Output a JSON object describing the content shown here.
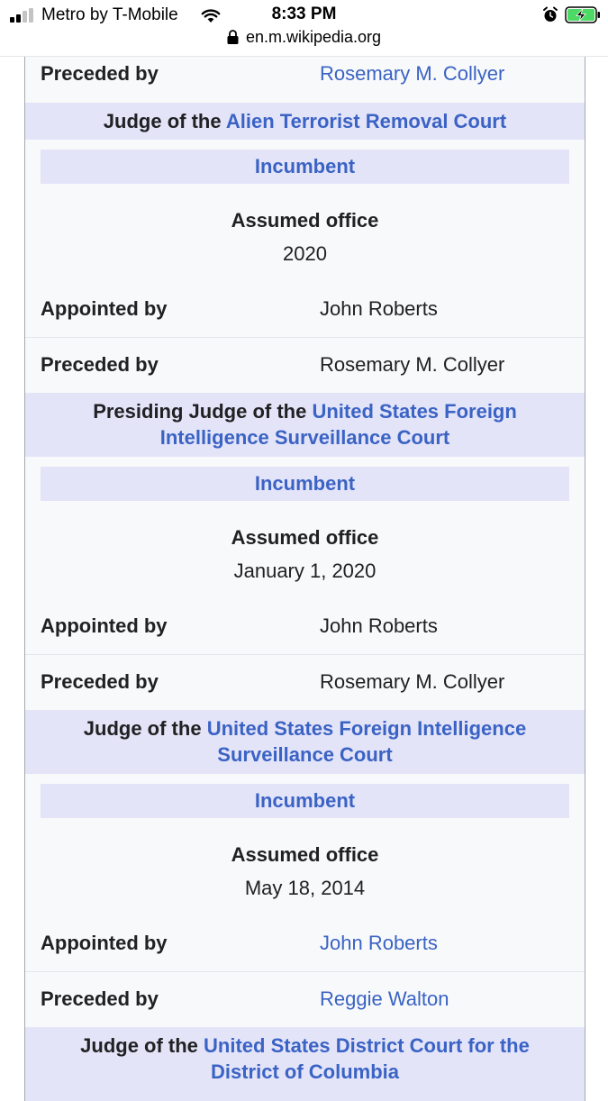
{
  "status_bar": {
    "carrier": "Metro by T-Mobile",
    "time": "8:33 PM",
    "url": "en.m.wikipedia.org",
    "icons": [
      "signal-bars-icon",
      "wifi-icon",
      "alarm-clock-icon",
      "battery-charging-icon",
      "lock-icon"
    ],
    "battery_color": "#4cd964"
  },
  "colors": {
    "link": "#3a63c4",
    "header_bg": "#e4e4f9",
    "infobox_bg": "#f8f9fa"
  },
  "infobox": {
    "top_row": {
      "label": "Preceded by",
      "value": "Rosemary M. Collyer"
    },
    "sections": [
      {
        "header_prefix": "Judge of the",
        "header_link": "Alien Terrorist Removal Court",
        "incumbent": "Incumbent",
        "assumed_label": "Assumed office",
        "assumed_value": "2020",
        "appointed_label": "Appointed by",
        "appointed_value": "John Roberts",
        "preceded_label": "Preceded by",
        "preceded_value": "Rosemary M. Collyer"
      },
      {
        "header_prefix": "Presiding Judge of the",
        "header_link_line1": "United States Foreign",
        "header_link_line2": "Intelligence Surveillance Court",
        "incumbent": "Incumbent",
        "assumed_label": "Assumed office",
        "assumed_value": "January 1, 2020",
        "appointed_label": "Appointed by",
        "appointed_value": "John Roberts",
        "preceded_label": "Preceded by",
        "preceded_value": "Rosemary M. Collyer"
      },
      {
        "header_prefix": "Judge of the",
        "header_link_line1": "United States Foreign Intelligence",
        "header_link_line2": "Surveillance Court",
        "incumbent": "Incumbent",
        "assumed_label": "Assumed office",
        "assumed_value": "May 18, 2014",
        "appointed_label": "Appointed by",
        "appointed_value": "John Roberts",
        "preceded_label": "Preceded by",
        "preceded_value": "Reggie Walton"
      },
      {
        "header_prefix": "Judge of the",
        "header_link_line1": "United States District Court for the",
        "header_link_line2": "District of Columbia"
      }
    ]
  }
}
